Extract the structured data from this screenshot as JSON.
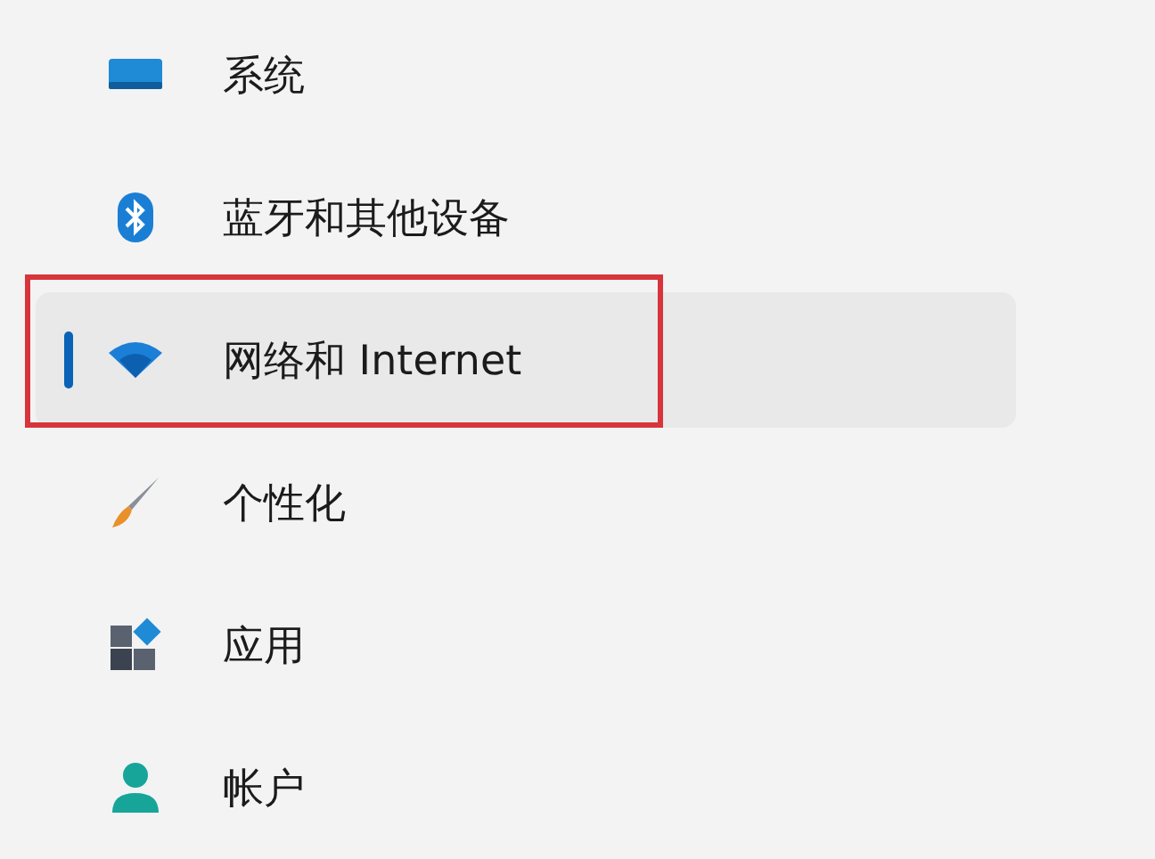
{
  "nav_items": [
    {
      "kind": "system",
      "label": "系统",
      "selected": false,
      "highlighted": false
    },
    {
      "kind": "bluetooth",
      "label": "蓝牙和其他设备",
      "selected": false,
      "highlighted": false
    },
    {
      "kind": "network",
      "label": "网络和 Internet",
      "selected": true,
      "highlighted": true
    },
    {
      "kind": "personalize",
      "label": "个性化",
      "selected": false,
      "highlighted": false
    },
    {
      "kind": "apps",
      "label": "应用",
      "selected": false,
      "highlighted": false
    },
    {
      "kind": "account",
      "label": "帐户",
      "selected": false,
      "highlighted": false
    }
  ]
}
